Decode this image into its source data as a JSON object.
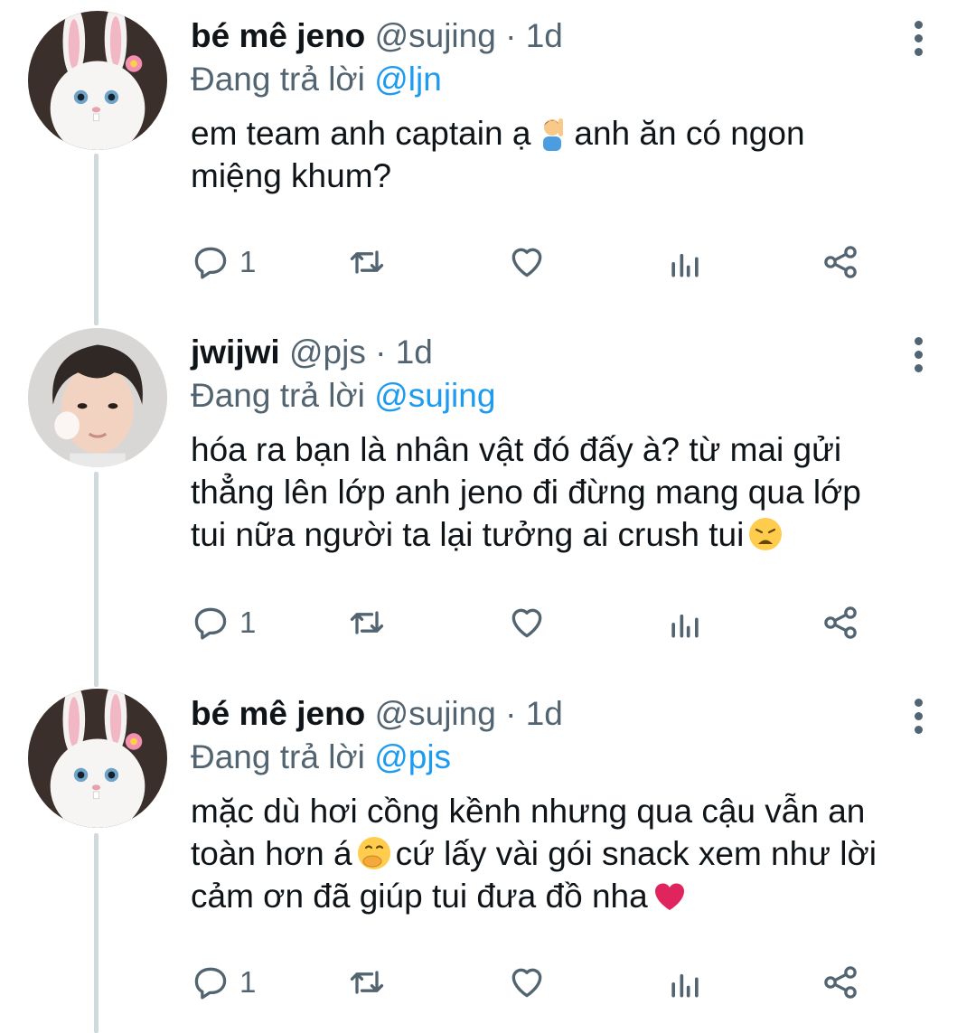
{
  "tweets": [
    {
      "name": "bé mê jeno",
      "handle": "@sujing",
      "dot": "·",
      "time": "1d",
      "reply_prefix": "Đang trả lời",
      "reply_mention": "@ljn",
      "text_a": "em team anh captain ạ",
      "emoji_1": "person-raising-hand-emoji",
      "text_b": "anh ăn có ngon miệng khum?",
      "reply_count": "1",
      "avatar": "bunny-avatar"
    },
    {
      "name": "jwijwi",
      "handle": "@pjs",
      "dot": "·",
      "time": "1d",
      "reply_prefix": "Đang trả lời",
      "reply_mention": "@sujing",
      "text_a": "hóa ra bạn là nhân vật đó đấy à? từ mai gửi thẳng lên lớp anh jeno đi đừng mang qua lớp tui nữa người ta lại tưởng ai crush tui",
      "emoji_1": "weary-face-emoji",
      "reply_count": "1",
      "avatar": "person-photo-avatar"
    },
    {
      "name": "bé mê jeno",
      "handle": "@sujing",
      "dot": "·",
      "time": "1d",
      "reply_prefix": "Đang trả lời",
      "reply_mention": "@pjs",
      "text_a": "mặc dù hơi cồng kềnh nhưng qua cậu vẫn an toàn hơn á",
      "emoji_1": "face-with-hand-over-mouth-emoji",
      "text_b": "cứ lấy vài gói snack xem như lời cảm ơn đã giúp tui đưa đồ nha",
      "emoji_2": "red-heart-emoji",
      "reply_count": "1",
      "avatar": "bunny-avatar"
    }
  ],
  "colors": {
    "text": "#0f1419",
    "secondary": "#536471",
    "mention": "#1d9bf0",
    "thread_line": "#cfd9de"
  }
}
